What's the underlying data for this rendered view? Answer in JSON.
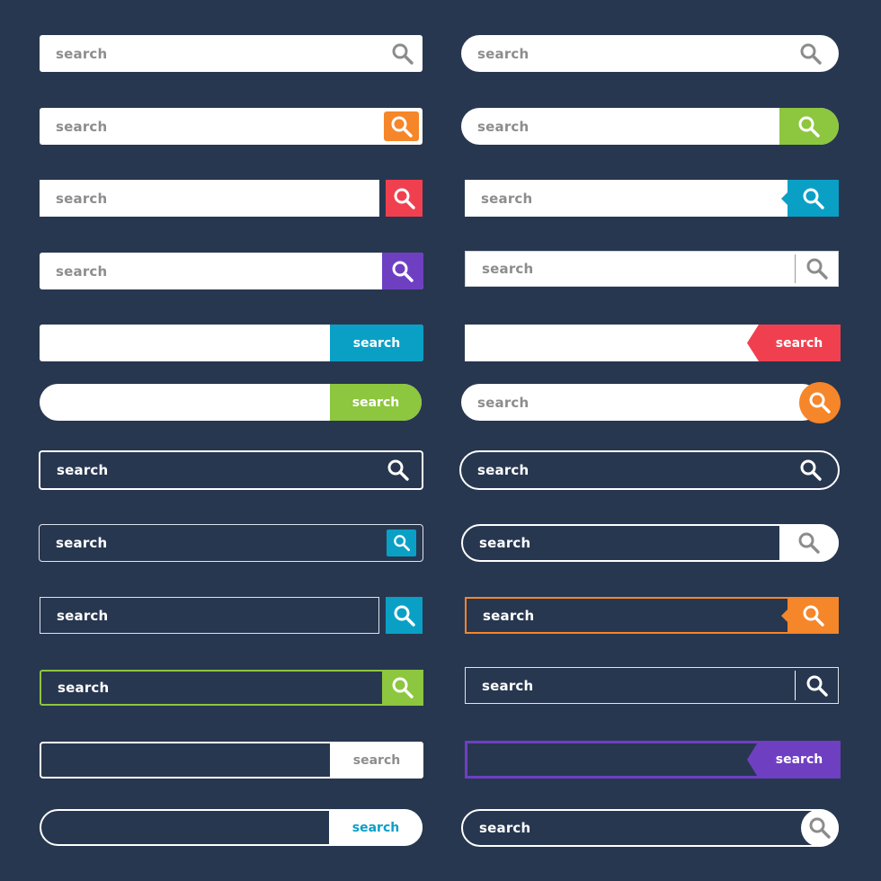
{
  "background": "#283750",
  "colors": {
    "white": "#ffffff",
    "placeholder_gray": "#8d8d8d",
    "icon_gray": "#8c8c8c",
    "orange": "#f5862a",
    "green": "#8dc63f",
    "red": "#f0404f",
    "purple": "#6f3fc2",
    "blue": "#0aa0c6",
    "outline_light": "#dfe4ea"
  },
  "left_bars": [
    {
      "placeholder": "search",
      "button": "search-icon"
    },
    {
      "placeholder": "search",
      "button": "search-icon",
      "accent": "#f5862a"
    },
    {
      "placeholder": "search",
      "button": "search-icon",
      "accent": "#f0404f"
    },
    {
      "placeholder": "search",
      "button": "search-icon",
      "accent": "#6f3fc2"
    },
    {
      "button_label": "search",
      "accent": "#0aa0c6"
    },
    {
      "button_label": "search",
      "accent": "#8dc63f"
    },
    {
      "placeholder": "search",
      "button": "search-icon"
    },
    {
      "placeholder": "search",
      "button": "search-icon",
      "accent": "#0aa0c6"
    },
    {
      "placeholder": "search",
      "button": "search-icon",
      "accent": "#0aa0c6"
    },
    {
      "placeholder": "search",
      "button": "search-icon",
      "accent": "#8dc63f"
    },
    {
      "button_label": "search"
    },
    {
      "button_label": "search",
      "accent": "#0aa0c6"
    }
  ],
  "right_bars": [
    {
      "placeholder": "search",
      "button": "search-icon"
    },
    {
      "placeholder": "search",
      "button": "search-icon",
      "accent": "#8dc63f"
    },
    {
      "placeholder": "search",
      "button": "search-icon",
      "accent": "#0aa0c6"
    },
    {
      "placeholder": "search",
      "button": "search-icon"
    },
    {
      "button_label": "search",
      "accent": "#f0404f"
    },
    {
      "placeholder": "search",
      "button": "search-icon",
      "accent": "#f5862a"
    },
    {
      "placeholder": "search",
      "button": "search-icon"
    },
    {
      "placeholder": "search",
      "button": "search-icon"
    },
    {
      "placeholder": "search",
      "button": "search-icon",
      "accent": "#f5862a"
    },
    {
      "placeholder": "search",
      "button": "search-icon"
    },
    {
      "button_label": "search",
      "accent": "#6f3fc2"
    },
    {
      "placeholder": "search",
      "button": "search-icon"
    }
  ]
}
